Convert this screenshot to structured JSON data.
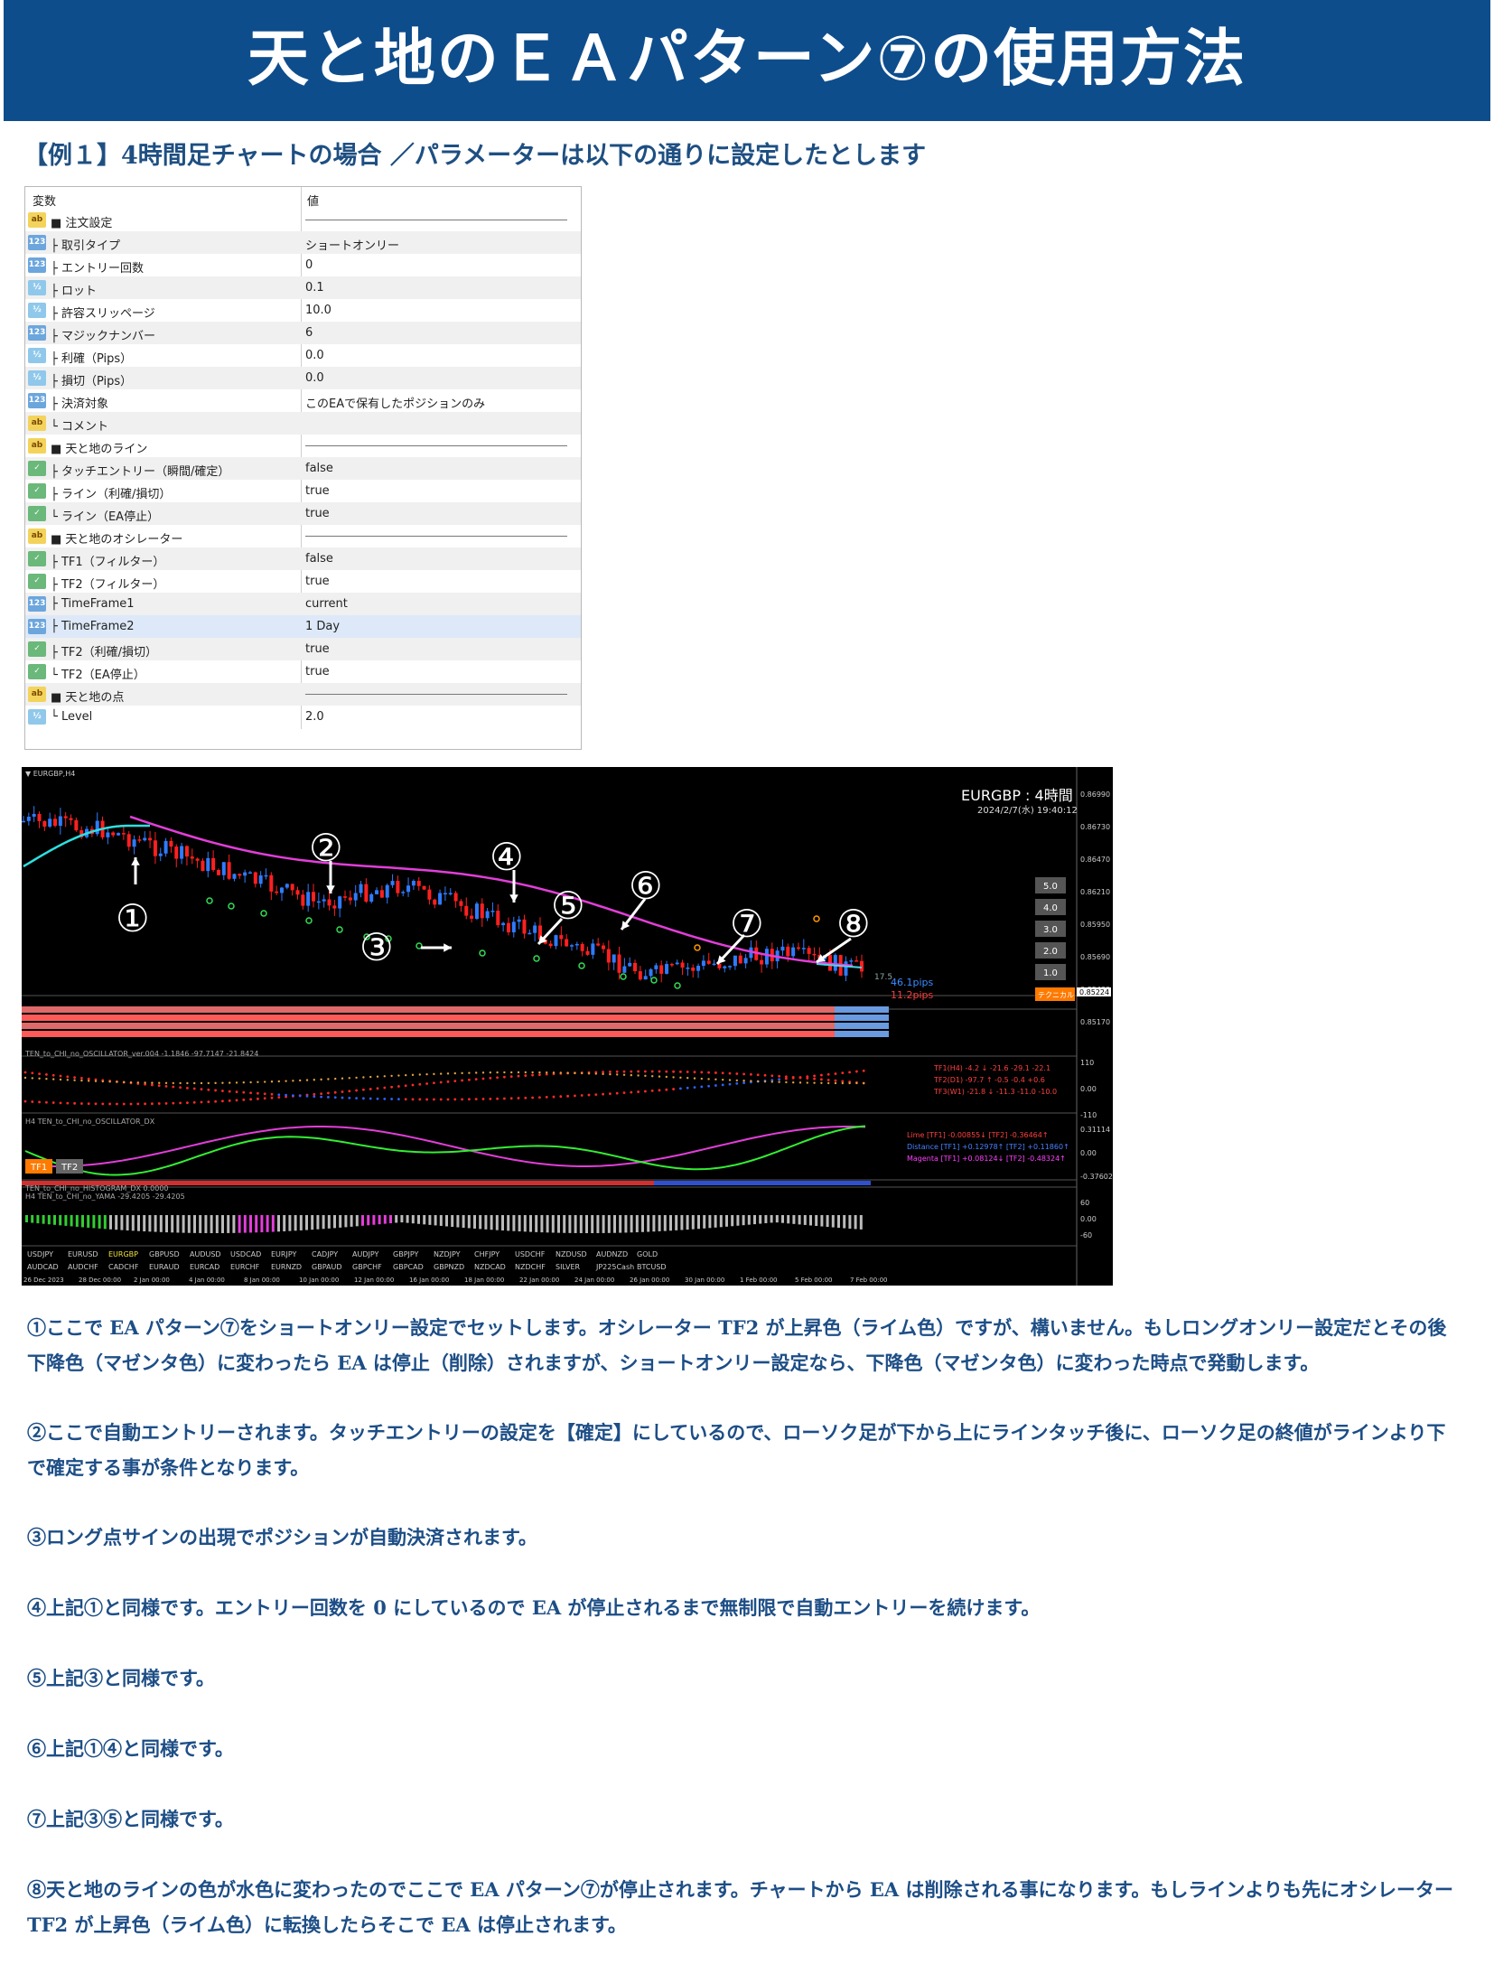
{
  "title": "天と地のＥＡパターン⑦の使用方法",
  "subtitle": "【例１】4時間足チャートの場合 ／パラメーターは以下の通りに設定したとします",
  "param_table": {
    "col_name": "変数",
    "col_value": "値",
    "rows": [
      {
        "icon": "ab",
        "name": "■ 注文設定",
        "value": ""
      },
      {
        "icon": "123",
        "name": "├ 取引タイプ",
        "value": "ショートオンリー"
      },
      {
        "icon": "123",
        "name": "├ エントリー回数",
        "value": "0"
      },
      {
        "icon": "1/2",
        "name": "├ ロット",
        "value": "0.1"
      },
      {
        "icon": "1/2",
        "name": "├ 許容スリッページ",
        "value": "10.0"
      },
      {
        "icon": "123",
        "name": "├ マジックナンバー",
        "value": "6"
      },
      {
        "icon": "1/2",
        "name": "├ 利確（Pips）",
        "value": "0.0"
      },
      {
        "icon": "1/2",
        "name": "├ 損切（Pips）",
        "value": "0.0"
      },
      {
        "icon": "123",
        "name": "├ 決済対象",
        "value": "このEAで保有したポジションのみ"
      },
      {
        "icon": "ab",
        "name": "└ コメント",
        "value": ""
      },
      {
        "icon": "ab",
        "name": "■ 天と地のライン",
        "value": ""
      },
      {
        "icon": "bool",
        "name": "├ タッチエントリー（瞬間/確定）",
        "value": "false"
      },
      {
        "icon": "bool",
        "name": "├ ライン（利確/損切）",
        "value": "true"
      },
      {
        "icon": "bool",
        "name": "└ ライン（EA停止）",
        "value": "true"
      },
      {
        "icon": "ab",
        "name": "■ 天と地のオシレーター",
        "value": ""
      },
      {
        "icon": "bool",
        "name": "├ TF1（フィルター）",
        "value": "false"
      },
      {
        "icon": "bool",
        "name": "├ TF2（フィルター）",
        "value": "true"
      },
      {
        "icon": "123",
        "name": "├ TimeFrame1",
        "value": "current"
      },
      {
        "icon": "123",
        "name": "├ TimeFrame2",
        "value": "1 Day"
      },
      {
        "icon": "bool",
        "name": "├ TF2（利確/損切）",
        "value": "true"
      },
      {
        "icon": "bool",
        "name": "└ TF2（EA停止）",
        "value": "true"
      },
      {
        "icon": "ab",
        "name": "■ 天と地の点",
        "value": ""
      },
      {
        "icon": "1/2",
        "name": "└ Level",
        "value": "2.0"
      }
    ]
  },
  "chart": {
    "symbol_tab": "▼ EURGBP,H4",
    "header_title": "EURGBP : 4時間",
    "header_time": "2024/2/7(水) 19:40:12",
    "price_axis": [
      "0.86990",
      "0.86730",
      "0.86470",
      "0.86210",
      "0.85950",
      "0.85690",
      "0.85430",
      "0.85170"
    ],
    "current_price": "0.85224",
    "side_buttons": [
      "5.0",
      "4.0",
      "3.0",
      "2.0",
      "1.0"
    ],
    "orange_button": "テクニカル",
    "pips_small": "17.5",
    "pips_blue": "46.1pips",
    "pips_red": "11.2pips",
    "markers": [
      "①",
      "②",
      "③",
      "④",
      "⑤",
      "⑥",
      "⑦",
      "⑧"
    ],
    "osc1_label": "TEN_to_CHI_no_OSCILLATOR_ver.004 -1.1846 -97.7147 -21.8424",
    "osc1_right": [
      "TF1(H4) -4.2  ↓ -21.6 -29.1 -22.1",
      "TF2(D1) -97.7  ↑ -0.5 -0.4 +0.6",
      "TF3(W1) -21.8  ↓ -11.3 -11.0 -10.0"
    ],
    "osc1_axis": [
      "110",
      "0.00",
      "-110"
    ],
    "osc2_label": "H4 TEN_to_CHI_no_OSCILLATOR_DX",
    "osc2_right": [
      "Lime [TF1] -0.00855↓  [TF2] -0.36464↑",
      "Distance [TF1] +0.12978↑  [TF2] +0.11860↑",
      "Magenta [TF1] +0.08124↓  [TF2] -0.48324↑"
    ],
    "osc2_axis": [
      "0.31114",
      "0.00",
      "-0.37602"
    ],
    "tf_buttons": [
      "TF1",
      "TF2"
    ],
    "hist_label": "TEN_to_CHI_no_HISTOGRAM_DX 0.0000",
    "yama_label": "H4 TEN_to_CHI_no_YAMA -29.4205 -29.4205",
    "yama_axis": [
      "60",
      "0.00",
      "-60"
    ],
    "symbols_row1": [
      "USDJPY",
      "EURUSD",
      "EURGBP",
      "GBPUSD",
      "AUDUSD",
      "USDCAD",
      "EURJPY",
      "CADJPY",
      "AUDJPY",
      "GBPJPY",
      "NZDJPY",
      "CHFJPY",
      "USDCHF",
      "NZDUSD",
      "AUDNZD",
      "GOLD"
    ],
    "symbols_row2": [
      "AUDCAD",
      "AUDCHF",
      "CADCHF",
      "EURAUD",
      "EURCAD",
      "EURCHF",
      "EURNZD",
      "GBPAUD",
      "GBPCHF",
      "GBPCAD",
      "GBPNZD",
      "NZDCAD",
      "NZDCHF",
      "SILVER",
      "JP225Cash",
      "BTCUSD"
    ],
    "time_axis": [
      "26 Dec 2023",
      "28 Dec 00:00",
      "2 Jan 00:00",
      "4 Jan 00:00",
      "8 Jan 00:00",
      "10 Jan 00:00",
      "12 Jan 00:00",
      "16 Jan 00:00",
      "18 Jan 00:00",
      "22 Jan 00:00",
      "24 Jan 00:00",
      "26 Jan 00:00",
      "30 Jan 00:00",
      "1 Feb 00:00",
      "5 Feb 00:00",
      "7 Feb 00:00"
    ]
  },
  "notes": [
    "①ここで EA パターン⑦をショートオンリー設定でセットします。オシレーター TF2 が上昇色（ライム色）ですが、構いません。もしロングオンリー設定だとその後下降色（マゼンタ色）に変わったら EA は停止（削除）されますが、ショートオンリー設定なら、下降色（マゼンタ色）に変わった時点で発動します。",
    "②ここで自動エントリーされます。タッチエントリーの設定を【確定】にしているので、ローソク足が下から上にラインタッチ後に、ローソク足の終値がラインより下で確定する事が条件となります。",
    "③ロング点サインの出現でポジションが自動決済されます。",
    "④上記①と同様です。エントリー回数を 0 にしているので EA が停止されるまで無制限で自動エントリーを続けます。",
    "⑤上記③と同様です。",
    "⑥上記①④と同様です。",
    "⑦上記③⑤と同様です。",
    "⑧天と地のラインの色が水色に変わったのでここで EA パターン⑦が停止されます。チャートから EA は削除される事になります。もしラインよりも先にオシレーター TF2 が上昇色（ライム色）に転換したらそこで EA は停止されます。"
  ]
}
